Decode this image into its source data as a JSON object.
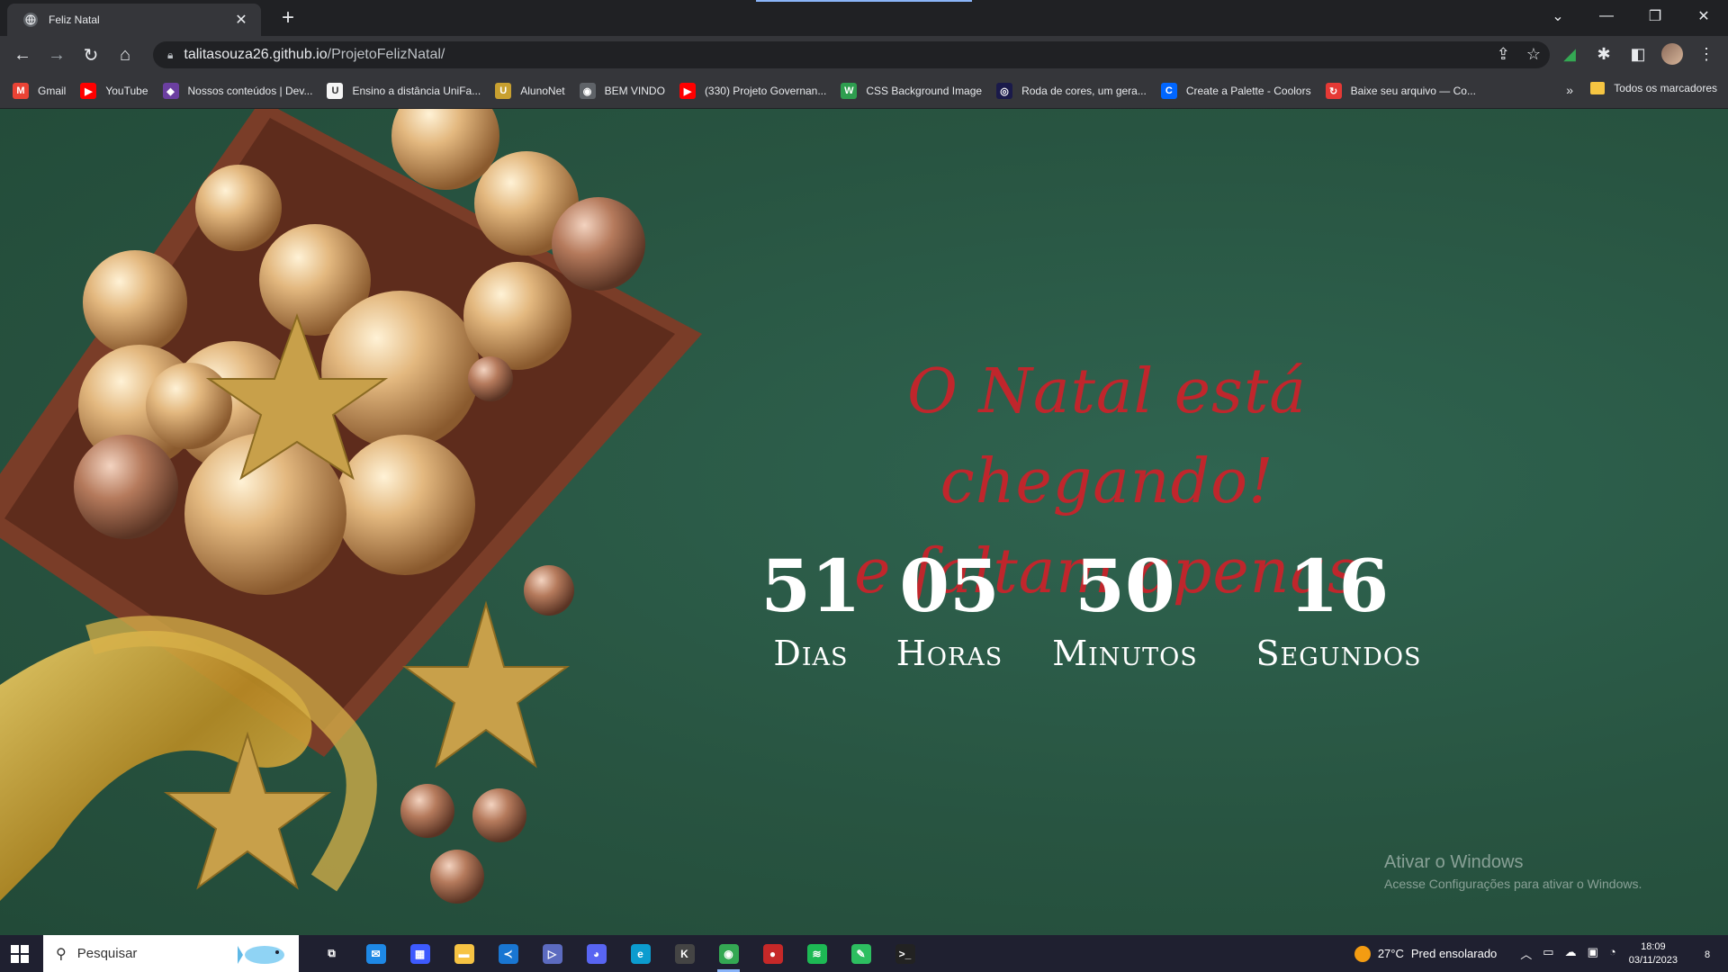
{
  "browser": {
    "tab_title": "Feliz Natal",
    "tab_close": "✕",
    "new_tab": "+",
    "window_controls": [
      "⌄",
      "—",
      "❐",
      "✕"
    ],
    "url_host": "talitasouza26.github.io",
    "url_path": "/ProjetoFelizNatal/",
    "nav_icons": [
      "back-icon",
      "forward-icon",
      "reload-icon",
      "home-icon"
    ]
  },
  "bookmarks": {
    "items": [
      {
        "label": "Gmail",
        "icon": "M",
        "color": "#ea4335"
      },
      {
        "label": "YouTube",
        "icon": "▶",
        "color": "#ff0000"
      },
      {
        "label": "Nossos conteúdos | Dev...",
        "icon": "◆",
        "color": "#6b3fa0"
      },
      {
        "label": "Ensino a distância UniFa...",
        "icon": "U",
        "color": "#f5f5f5"
      },
      {
        "label": "AlunoNet",
        "icon": "U",
        "color": "#c8a030"
      },
      {
        "label": "BEM VINDO",
        "icon": "◉",
        "color": "#5f6368"
      },
      {
        "label": "(330) Projeto Governan...",
        "icon": "▶",
        "color": "#ff0000"
      },
      {
        "label": "CSS Background Image",
        "icon": "W",
        "color": "#2e9e4f"
      },
      {
        "label": "Roda de cores, um gera...",
        "icon": "◎",
        "color": "#1a1a4a"
      },
      {
        "label": "Create a Palette - Coolors",
        "icon": "C",
        "color": "#0066ff"
      },
      {
        "label": "Baixe seu arquivo — Co...",
        "icon": "↻",
        "color": "#e53935"
      }
    ],
    "more": "»",
    "all_label": "Todos os marcadores"
  },
  "page": {
    "headline_1": "O Natal está chegando!",
    "headline_2": "e faltam apenas",
    "countdown": [
      {
        "value": "51",
        "label": "Dias"
      },
      {
        "value": "05",
        "label": "Horas"
      },
      {
        "value": "50",
        "label": "Minutos"
      },
      {
        "value": "16",
        "label": "Segundos"
      }
    ],
    "watermark_title": "Ativar o Windows",
    "watermark_sub": "Acesse Configurações para ativar o Windows."
  },
  "taskbar": {
    "search_placeholder": "Pesquisar",
    "weather_temp": "27°C",
    "weather_text": "Pred ensolarado",
    "time": "18:09",
    "date": "03/11/2023",
    "notification_count": "8",
    "apps": [
      {
        "name": "task-view-icon",
        "glyph": "⧉",
        "color": "transparent"
      },
      {
        "name": "mail-icon",
        "glyph": "✉",
        "color": "#1e88e5"
      },
      {
        "name": "store-icon",
        "glyph": "▦",
        "color": "#3d5afe"
      },
      {
        "name": "file-explorer-icon",
        "glyph": "▬",
        "color": "#f6c343"
      },
      {
        "name": "vscode-icon",
        "glyph": "≺",
        "color": "#1976d2"
      },
      {
        "name": "media-icon",
        "glyph": "▷",
        "color": "#5c6bc0"
      },
      {
        "name": "discord-icon",
        "glyph": "◕",
        "color": "#5865f2"
      },
      {
        "name": "edge-icon",
        "glyph": "e",
        "color": "#0c9ccf"
      },
      {
        "name": "k-app-icon",
        "glyph": "K",
        "color": "#444"
      },
      {
        "name": "chrome-icon",
        "glyph": "◉",
        "color": "#34a853"
      },
      {
        "name": "record-icon",
        "glyph": "●",
        "color": "#c62828"
      },
      {
        "name": "spotify-icon",
        "glyph": "≋",
        "color": "#1db954"
      },
      {
        "name": "evernote-icon",
        "glyph": "✎",
        "color": "#2dbe60"
      },
      {
        "name": "terminal-icon",
        "glyph": ">_",
        "color": "#222"
      }
    ]
  }
}
